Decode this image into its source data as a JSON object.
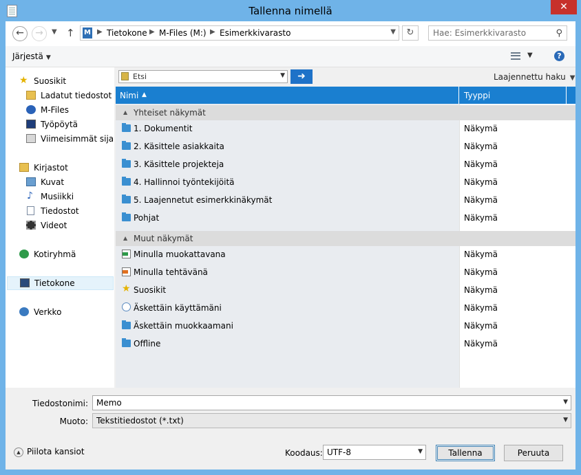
{
  "window": {
    "title": "Tallenna nimellä",
    "close": "✕"
  },
  "nav": {
    "breadcrumbs": [
      "Tietokone",
      "M-Files (M:)",
      "Esimerkkivarasto"
    ],
    "search_placeholder": "Hae: Esimerkkivarasto"
  },
  "toolbar": {
    "organize_label": "Järjestä"
  },
  "sidebar": {
    "favorites": [
      {
        "label": "Suosikit",
        "icon": "star-icon"
      },
      {
        "label": "Ladatut tiedostot",
        "icon": "downloads-folder-icon"
      },
      {
        "label": "M-Files",
        "icon": "mfiles-icon"
      },
      {
        "label": "Työpöytä",
        "icon": "desktop-icon"
      },
      {
        "label": "Viimeisimmät sijainnit",
        "icon": "recent-places-icon"
      }
    ],
    "libraries": [
      {
        "label": "Kirjastot",
        "icon": "libraries-icon"
      },
      {
        "label": "Kuvat",
        "icon": "pictures-icon"
      },
      {
        "label": "Musiikki",
        "icon": "music-icon"
      },
      {
        "label": "Tiedostot",
        "icon": "documents-icon"
      },
      {
        "label": "Videot",
        "icon": "videos-icon"
      }
    ],
    "homegroup": {
      "label": "Kotiryhmä",
      "icon": "homegroup-icon"
    },
    "computer": {
      "label": "Tietokone",
      "icon": "computer-icon"
    },
    "network": {
      "label": "Verkko",
      "icon": "network-icon"
    }
  },
  "search_bar": {
    "etsi_label": "Etsi",
    "go_arrow": "➜",
    "advanced_label": "Laajennettu haku"
  },
  "columns": {
    "name": "Nimi",
    "type": "Tyyppi"
  },
  "groups": [
    {
      "label": "Yhteiset näkymät",
      "rows": [
        {
          "name": "1. Dokumentit",
          "type": "Näkymä",
          "icon": "view-folder-icon"
        },
        {
          "name": "2. Käsittele asiakkaita",
          "type": "Näkymä",
          "icon": "view-folder-icon"
        },
        {
          "name": "3. Käsittele projekteja",
          "type": "Näkymä",
          "icon": "view-folder-icon"
        },
        {
          "name": "4. Hallinnoi työntekijöitä",
          "type": "Näkymä",
          "icon": "view-folder-icon"
        },
        {
          "name": "5. Laajennetut esimerkkinäkymät",
          "type": "Näkymä",
          "icon": "view-folder-icon"
        },
        {
          "name": "Pohjat",
          "type": "Näkymä",
          "icon": "view-folder-icon"
        }
      ]
    },
    {
      "label": "Muut näkymät",
      "rows": [
        {
          "name": "Minulla muokattavana",
          "type": "Näkymä",
          "icon": "checked-out-icon"
        },
        {
          "name": "Minulla tehtävänä",
          "type": "Näkymä",
          "icon": "assigned-icon"
        },
        {
          "name": "Suosikit",
          "type": "Näkymä",
          "icon": "star-icon"
        },
        {
          "name": "Äskettäin käyttämäni",
          "type": "Näkymä",
          "icon": "recently-accessed-icon"
        },
        {
          "name": "Äskettäin muokkaamani",
          "type": "Näkymä",
          "icon": "view-folder-icon"
        },
        {
          "name": "Offline",
          "type": "Näkymä",
          "icon": "view-folder-icon"
        }
      ]
    }
  ],
  "form": {
    "filename_label": "Tiedostonimi:",
    "filename_value": "Memo",
    "format_label": "Muoto:",
    "format_value": "Tekstitiedostot (*.txt)",
    "hide_folders_label": "Piilota kansiot",
    "encoding_label": "Koodaus:",
    "encoding_value": "UTF-8",
    "save_label": "Tallenna",
    "cancel_label": "Peruuta"
  }
}
